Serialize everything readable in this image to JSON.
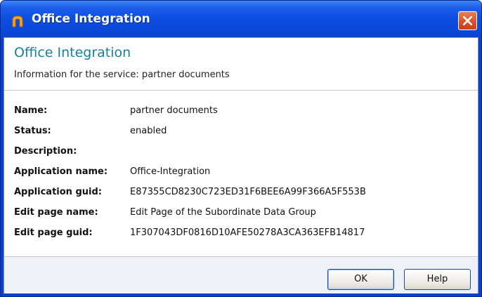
{
  "window": {
    "title": "Office Integration",
    "close_icon": "close-icon",
    "app_icon": "office-integration-icon"
  },
  "header": {
    "title": "Office Integration",
    "subtitle": "Information for the service: partner documents"
  },
  "info": {
    "rows": [
      {
        "label": "Name:",
        "value": "partner documents"
      },
      {
        "label": "Status:",
        "value": "enabled"
      },
      {
        "label": "Description:",
        "value": ""
      },
      {
        "label": "Application name:",
        "value": "Office-Integration"
      },
      {
        "label": "Application guid:",
        "value": "E87355CD8230C723ED31F6BEE6A99F366A5F553B"
      },
      {
        "label": "Edit page name:",
        "value": "Edit Page of the Subordinate Data Group"
      },
      {
        "label": "Edit page guid:",
        "value": "1F307043DF0816D10AFE50278A3CA363EFB14817"
      }
    ]
  },
  "footer": {
    "ok_label": "OK",
    "help_label": "Help"
  },
  "colors": {
    "title_bar": "#0b4ee0",
    "header_title": "#17809a",
    "close_button": "#d8512c"
  }
}
